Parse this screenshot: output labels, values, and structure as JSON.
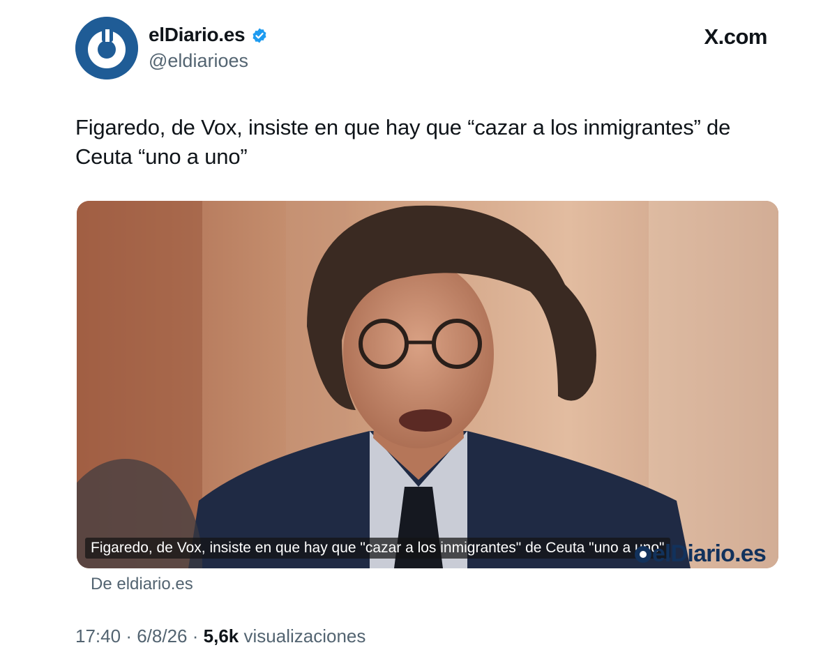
{
  "author": {
    "name": "elDiario.es",
    "handle": "@eldiarioes",
    "verified": true,
    "avatar_color": "#1f5c96"
  },
  "site_label": "X.com",
  "tweet": {
    "text": "Figaredo, de Vox, insiste en que hay que “cazar a los inmigrantes” de Ceuta “uno a uno”"
  },
  "media": {
    "caption": "Figaredo, de Vox, insiste en que hay que \"cazar a los inmigrantes\" de Ceuta \"uno a uno\"",
    "logo_text": "elDiario.es",
    "source_link": "De eldiario.es"
  },
  "meta": {
    "time": "17:40",
    "separator": "·",
    "date": "6/8/26",
    "views_count": "5,6k",
    "views_label": "visualizaciones"
  },
  "colors": {
    "text_primary": "#0f1419",
    "text_secondary": "#536471",
    "verified_blue": "#1d9bf0",
    "logo_navy": "#12325c"
  }
}
